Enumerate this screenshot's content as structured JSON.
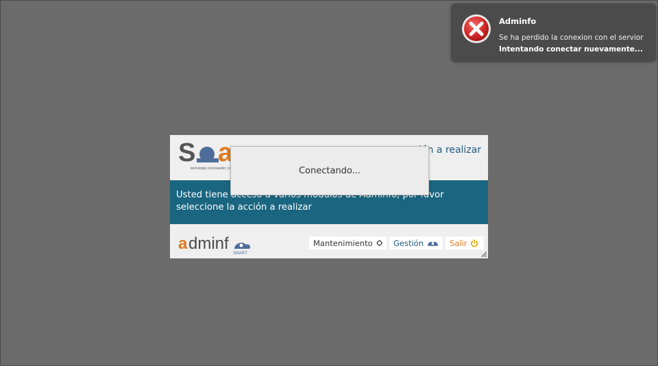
{
  "toast": {
    "title": "Adminfo",
    "message": "Se ha perdido la conexion con el servior",
    "status": "Intentando conectar nuevamente...",
    "icon": "error-x-icon"
  },
  "dialog": {
    "header_title": "ión a realizar",
    "brand_logo": {
      "text": "Solu",
      "tagline": "tecnología | innovación | sol"
    },
    "description": "Usted tiene acceso a varios modulos de Adminfo, por favor seleccione la acción a realizar",
    "footer_logo": {
      "text_a": "a",
      "text_rest": "dminf",
      "subtext": "SMART"
    },
    "buttons": {
      "mantenimiento": "Mantenimiento",
      "gestion": "Gestión",
      "salir": "Salir"
    }
  },
  "overlay": {
    "text": "Conectando..."
  },
  "colors": {
    "background": "#6b6b6b",
    "band": "#1a6580",
    "accent_orange": "#e07a1f",
    "accent_blue": "#1f5a7a",
    "toast_bg": "#4b4b4b",
    "error_red": "#d42a2a"
  }
}
